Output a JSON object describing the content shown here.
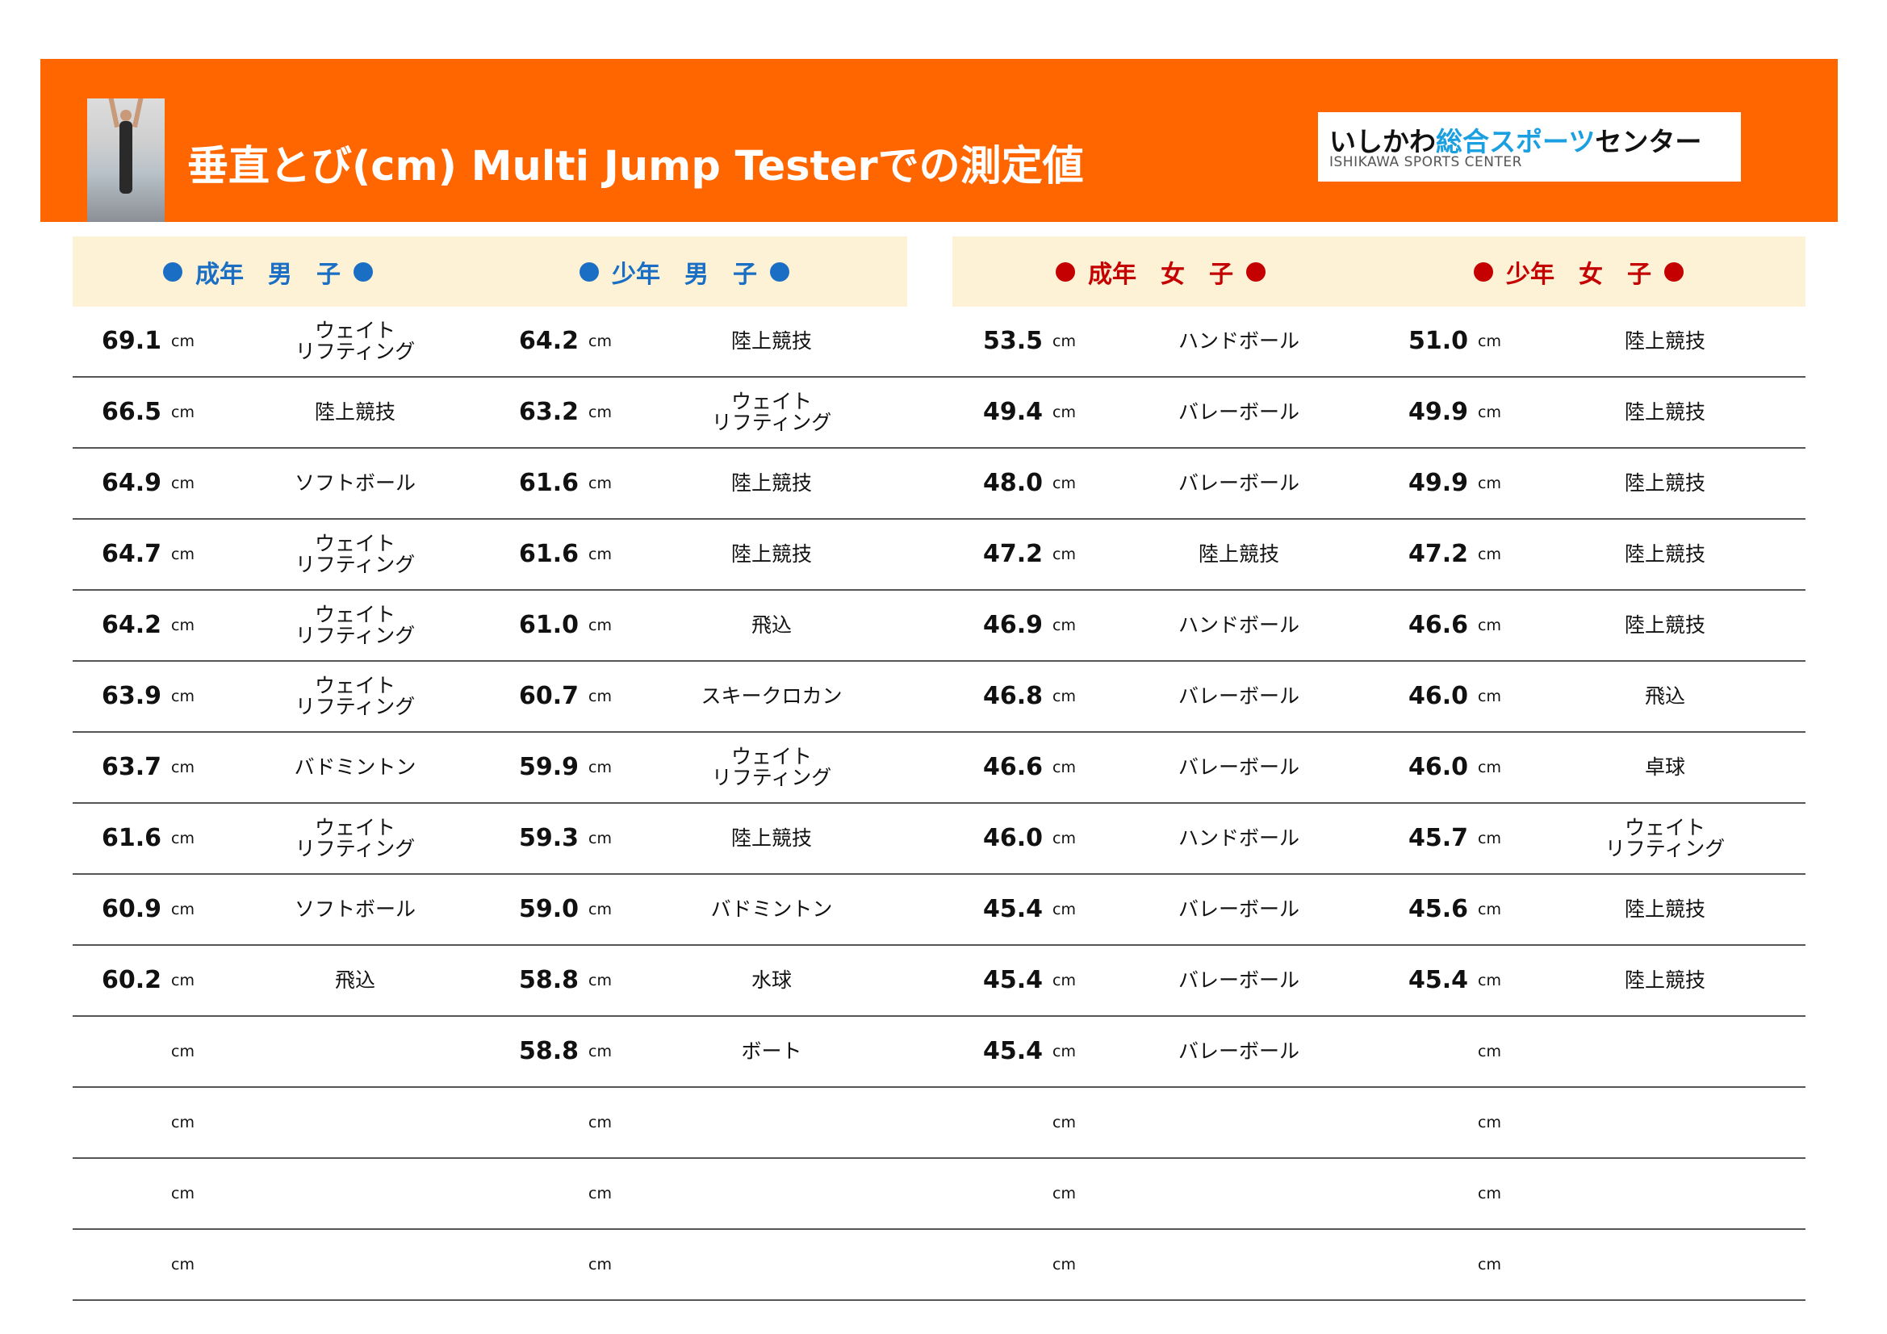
{
  "header": {
    "title": "垂直とび(cm) Multi Jump Testerでの測定値",
    "logo_main_black": "いしかわ",
    "logo_main_blue": "総合スポーツ",
    "logo_main_black2": "センター",
    "logo_sub": "ISHIKAWA SPORTS CENTER",
    "accent_color": "#ff6600"
  },
  "categories": [
    "成年　男　子",
    "少年　男　子",
    "成年　女　子",
    "少年　女　子"
  ],
  "unit": "cm",
  "rows": [
    [
      {
        "v": "69.1",
        "s": "ウェイト\nリフティング"
      },
      {
        "v": "64.2",
        "s": "陸上競技"
      },
      {
        "v": "53.5",
        "s": "ハンドボール"
      },
      {
        "v": "51.0",
        "s": "陸上競技"
      }
    ],
    [
      {
        "v": "66.5",
        "s": "陸上競技"
      },
      {
        "v": "63.2",
        "s": "ウェイト\nリフティング"
      },
      {
        "v": "49.4",
        "s": "バレーボール"
      },
      {
        "v": "49.9",
        "s": "陸上競技"
      }
    ],
    [
      {
        "v": "64.9",
        "s": "ソフトボール"
      },
      {
        "v": "61.6",
        "s": "陸上競技"
      },
      {
        "v": "48.0",
        "s": "バレーボール"
      },
      {
        "v": "49.9",
        "s": "陸上競技"
      }
    ],
    [
      {
        "v": "64.7",
        "s": "ウェイト\nリフティング"
      },
      {
        "v": "61.6",
        "s": "陸上競技"
      },
      {
        "v": "47.2",
        "s": "陸上競技"
      },
      {
        "v": "47.2",
        "s": "陸上競技"
      }
    ],
    [
      {
        "v": "64.2",
        "s": "ウェイト\nリフティング"
      },
      {
        "v": "61.0",
        "s": "飛込"
      },
      {
        "v": "46.9",
        "s": "ハンドボール"
      },
      {
        "v": "46.6",
        "s": "陸上競技"
      }
    ],
    [
      {
        "v": "63.9",
        "s": "ウェイト\nリフティング"
      },
      {
        "v": "60.7",
        "s": "スキークロカン"
      },
      {
        "v": "46.8",
        "s": "バレーボール"
      },
      {
        "v": "46.0",
        "s": "飛込"
      }
    ],
    [
      {
        "v": "63.7",
        "s": "バドミントン"
      },
      {
        "v": "59.9",
        "s": "ウェイト\nリフティング"
      },
      {
        "v": "46.6",
        "s": "バレーボール"
      },
      {
        "v": "46.0",
        "s": "卓球"
      }
    ],
    [
      {
        "v": "61.6",
        "s": "ウェイト\nリフティング"
      },
      {
        "v": "59.3",
        "s": "陸上競技"
      },
      {
        "v": "46.0",
        "s": "ハンドボール"
      },
      {
        "v": "45.7",
        "s": "ウェイト\nリフティング"
      }
    ],
    [
      {
        "v": "60.9",
        "s": "ソフトボール"
      },
      {
        "v": "59.0",
        "s": "バドミントン"
      },
      {
        "v": "45.4",
        "s": "バレーボール"
      },
      {
        "v": "45.6",
        "s": "陸上競技"
      }
    ],
    [
      {
        "v": "60.2",
        "s": "飛込"
      },
      {
        "v": "58.8",
        "s": "水球"
      },
      {
        "v": "45.4",
        "s": "バレーボール"
      },
      {
        "v": "45.4",
        "s": "陸上競技"
      }
    ],
    [
      {
        "v": "",
        "s": ""
      },
      {
        "v": "58.8",
        "s": "ボート"
      },
      {
        "v": "45.4",
        "s": "バレーボール"
      },
      {
        "v": "",
        "s": ""
      }
    ],
    [
      {
        "v": "",
        "s": ""
      },
      {
        "v": "",
        "s": ""
      },
      {
        "v": "",
        "s": ""
      },
      {
        "v": "",
        "s": ""
      }
    ],
    [
      {
        "v": "",
        "s": ""
      },
      {
        "v": "",
        "s": ""
      },
      {
        "v": "",
        "s": ""
      },
      {
        "v": "",
        "s": ""
      }
    ],
    [
      {
        "v": "",
        "s": ""
      },
      {
        "v": "",
        "s": ""
      },
      {
        "v": "",
        "s": ""
      },
      {
        "v": "",
        "s": ""
      }
    ]
  ]
}
